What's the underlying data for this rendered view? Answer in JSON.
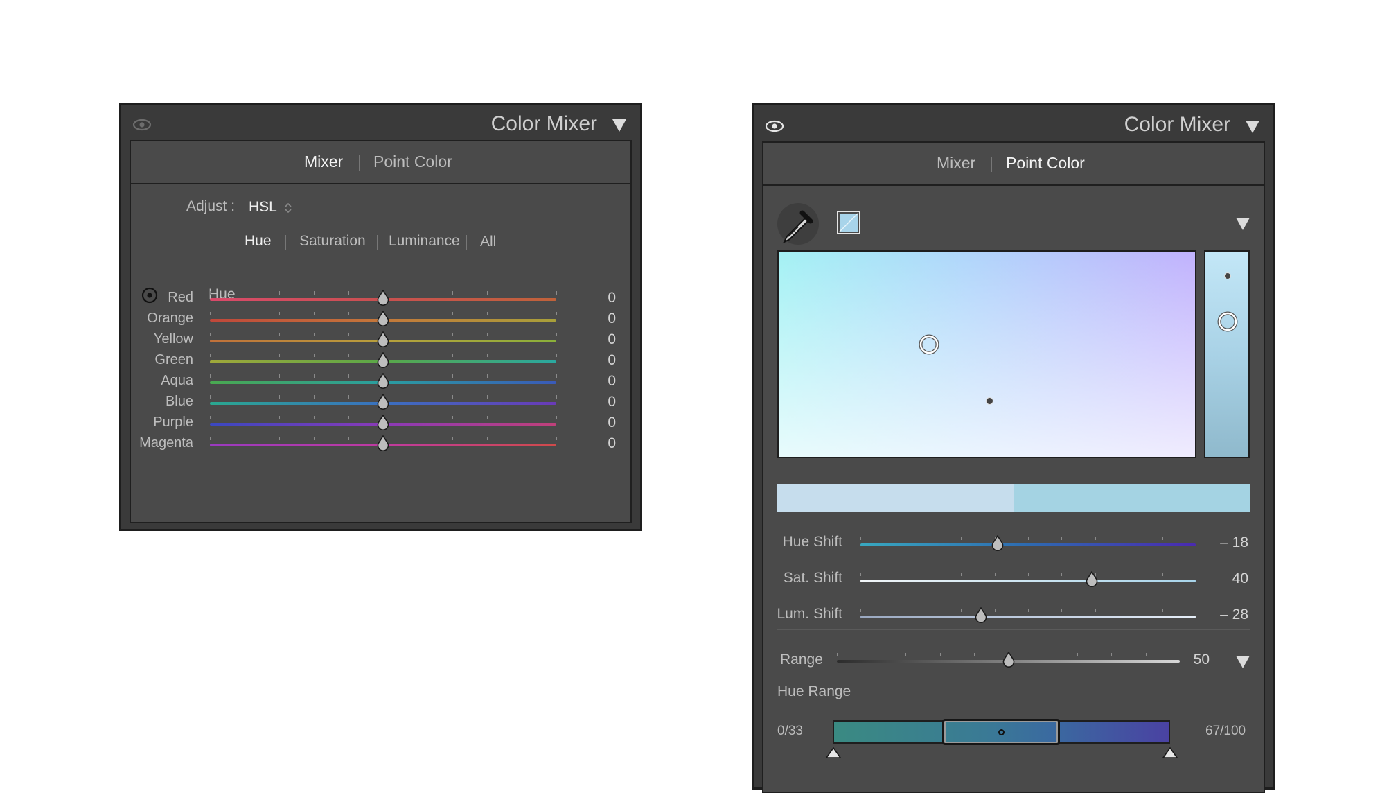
{
  "left_panel": {
    "title": "Color Mixer",
    "tabs": [
      {
        "label": "Mixer",
        "active": true
      },
      {
        "label": "Point Color",
        "active": false
      }
    ],
    "adjust_label": "Adjust :",
    "adjust_value": "HSL",
    "modes": [
      {
        "label": "Hue",
        "active": true
      },
      {
        "label": "Saturation",
        "active": false
      },
      {
        "label": "Luminance",
        "active": false
      },
      {
        "label": "All",
        "active": false
      }
    ],
    "section_label": "Hue",
    "sliders": [
      {
        "label": "Red",
        "value": "0",
        "gradient": [
          "#d94a6a",
          "#c95050",
          "#c0623a"
        ]
      },
      {
        "label": "Orange",
        "value": "0",
        "gradient": [
          "#c0473a",
          "#c4783a",
          "#a8a03a"
        ]
      },
      {
        "label": "Yellow",
        "value": "0",
        "gradient": [
          "#c0703a",
          "#b8a03c",
          "#8ab03a"
        ]
      },
      {
        "label": "Green",
        "value": "0",
        "gradient": [
          "#a0a83a",
          "#5aa848",
          "#2aa8a0"
        ]
      },
      {
        "label": "Aqua",
        "value": "0",
        "gradient": [
          "#4aa850",
          "#2a9ea0",
          "#3a5ab8"
        ]
      },
      {
        "label": "Blue",
        "value": "0",
        "gradient": [
          "#2aa890",
          "#3a70c0",
          "#6a3ab8"
        ]
      },
      {
        "label": "Purple",
        "value": "0",
        "gradient": [
          "#3a48c0",
          "#8a3ab8",
          "#c0407a"
        ]
      },
      {
        "label": "Magenta",
        "value": "0",
        "gradient": [
          "#9a3ac0",
          "#c03aa0",
          "#d04a4a"
        ]
      }
    ]
  },
  "right_panel": {
    "title": "Color Mixer",
    "tabs": [
      {
        "label": "Mixer",
        "active": false
      },
      {
        "label": "Point Color",
        "active": true
      }
    ],
    "swatch_color": "#a8d4ea",
    "before_color": "#c6dded",
    "after_color": "#a4d3e3",
    "shifts": [
      {
        "label": "Hue Shift",
        "value": "– 18",
        "fraction": 0.41
      },
      {
        "label": "Sat. Shift",
        "value": "40",
        "fraction": 0.69
      },
      {
        "label": "Lum. Shift",
        "value": "– 28",
        "fraction": 0.36
      }
    ],
    "range": {
      "label": "Range",
      "value": "50",
      "fraction": 0.5
    },
    "hue_range": {
      "label": "Hue Range",
      "left_value": "0/33",
      "right_value": "67/100"
    }
  }
}
